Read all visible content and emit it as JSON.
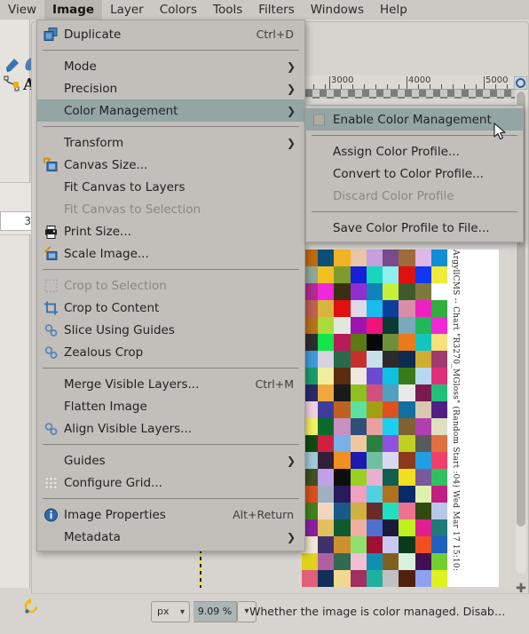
{
  "menubar": {
    "items": [
      {
        "label": "View",
        "active": false
      },
      {
        "label": "Image",
        "active": true
      },
      {
        "label": "Layer",
        "active": false
      },
      {
        "label": "Colors",
        "active": false
      },
      {
        "label": "Tools",
        "active": false
      },
      {
        "label": "Filters",
        "active": false
      },
      {
        "label": "Windows",
        "active": false
      },
      {
        "label": "Help",
        "active": false
      }
    ]
  },
  "image_menu": {
    "rows": [
      {
        "type": "item",
        "label": "Duplicate",
        "accel": "Ctrl+D",
        "icon": "duplicate-icon",
        "state": "normal"
      },
      {
        "type": "sep"
      },
      {
        "type": "item",
        "label": "Mode",
        "submenu": true,
        "state": "normal"
      },
      {
        "type": "item",
        "label": "Precision",
        "submenu": true,
        "state": "normal"
      },
      {
        "type": "item",
        "label": "Color Management",
        "submenu": true,
        "state": "highlighted"
      },
      {
        "type": "sep"
      },
      {
        "type": "item",
        "label": "Transform",
        "submenu": true,
        "state": "normal"
      },
      {
        "type": "item",
        "label": "Canvas Size...",
        "icon": "canvas-size-icon",
        "state": "normal"
      },
      {
        "type": "item",
        "label": "Fit Canvas to Layers",
        "state": "normal"
      },
      {
        "type": "item",
        "label": "Fit Canvas to Selection",
        "state": "disabled"
      },
      {
        "type": "item",
        "label": "Print Size...",
        "icon": "printer-icon",
        "state": "normal"
      },
      {
        "type": "item",
        "label": "Scale Image...",
        "icon": "scale-image-icon",
        "state": "normal"
      },
      {
        "type": "sep"
      },
      {
        "type": "item",
        "label": "Crop to Selection",
        "icon": "crop-selection-icon",
        "state": "disabled"
      },
      {
        "type": "item",
        "label": "Crop to Content",
        "icon": "crop-content-icon",
        "state": "normal"
      },
      {
        "type": "item",
        "label": "Slice Using Guides",
        "icon": "plugin-icon",
        "state": "normal"
      },
      {
        "type": "item",
        "label": "Zealous Crop",
        "icon": "plugin-icon",
        "state": "normal"
      },
      {
        "type": "sep"
      },
      {
        "type": "item",
        "label": "Merge Visible Layers...",
        "accel": "Ctrl+M",
        "state": "normal"
      },
      {
        "type": "item",
        "label": "Flatten Image",
        "state": "normal"
      },
      {
        "type": "item",
        "label": "Align Visible Layers...",
        "icon": "plugin-icon",
        "state": "normal"
      },
      {
        "type": "sep"
      },
      {
        "type": "item",
        "label": "Guides",
        "submenu": true,
        "state": "normal"
      },
      {
        "type": "item",
        "label": "Configure Grid...",
        "icon": "grid-icon",
        "state": "normal"
      },
      {
        "type": "sep"
      },
      {
        "type": "item",
        "label": "Image Properties",
        "accel": "Alt+Return",
        "icon": "info-icon",
        "state": "normal"
      },
      {
        "type": "item",
        "label": "Metadata",
        "submenu": true,
        "state": "normal"
      }
    ]
  },
  "color_management_submenu": {
    "rows": [
      {
        "type": "checkitem",
        "label": "Enable Color Management",
        "checked": false,
        "state": "highlighted"
      },
      {
        "type": "sep"
      },
      {
        "type": "item",
        "label": "Assign Color Profile...",
        "state": "normal"
      },
      {
        "type": "item",
        "label": "Convert to Color Profile...",
        "state": "normal"
      },
      {
        "type": "item",
        "label": "Discard Color Profile",
        "state": "disabled"
      },
      {
        "type": "sep"
      },
      {
        "type": "item",
        "label": "Save Color Profile to File...",
        "state": "normal"
      }
    ]
  },
  "canvas": {
    "vertical_caption": "ArgyllCMS -- Chart \"R3270_MGloss\" (Random Start :04) Wed Mar 17 15:10:",
    "ruler_labels": [
      "3000",
      "4000",
      "5000"
    ]
  },
  "statusbar": {
    "unit": "px",
    "zoom": "9.09 %",
    "message": "Whether the image is color managed. Disab…"
  },
  "left_panel": {
    "value": "3"
  },
  "colors": {
    "menu_bg": "#c2bfba",
    "menu_highlight": "#93a5a5",
    "menubar_bg": "#ccc8c3",
    "window_bg": "#d7d3ce",
    "zoom_field_bg": "#adb6b6",
    "layer_boundary_yellow": "#f7e400"
  },
  "chart_swatches": [
    "#c06a10",
    "#0b4f74",
    "#f0b323",
    "#e6c6a6",
    "#c79ee0",
    "#7a4b8a",
    "#a06a3c",
    "#dfb6e8",
    "#0e8fd8",
    "#8fa79a",
    "#f0c020",
    "#7f9b2e",
    "#1520d8",
    "#16d6c0",
    "#8df0ef",
    "#e01010",
    "#1038f0",
    "#f0ea3a",
    "#b32a94",
    "#f028d8",
    "#3a3010",
    "#8f2fd0",
    "#1084b8",
    "#c6f03a",
    "#3e5b2c",
    "#7f7a3c",
    "#ffffff",
    "#bf6050",
    "#d8b43e",
    "#e01010",
    "#e0d8e8",
    "#19baf0",
    "#0c3f9c",
    "#d88fa6",
    "#f01fc0",
    "#2fae3c",
    "#b87218",
    "#aada3c",
    "#dfe8da",
    "#9c14b0",
    "#f0147a",
    "#0b3a30",
    "#79aabc",
    "#21b85a",
    "#f028d8",
    "#2e2e2e",
    "#13e64a",
    "#b81a5a",
    "#5c7a12",
    "#080808",
    "#6f8f3c",
    "#eb7a1a",
    "#13c4c0",
    "#f7e17a",
    "#3c9cdb",
    "#d7d2e0",
    "#2a6a4a",
    "#c43030",
    "#c8e0ec",
    "#2b2b2b",
    "#0e2a50",
    "#d0ac30",
    "#a03a70",
    "#1b9c6a",
    "#eef0a0",
    "#5a2c10",
    "#f0e8e0",
    "#6c4ad0",
    "#10c0e0",
    "#3a7a1a",
    "#b8d8f0",
    "#e0307a",
    "#2a2a6a",
    "#f0a83c",
    "#1a1a1a",
    "#8fc020",
    "#d0507a",
    "#50a0c0",
    "#e8e8e8",
    "#7a1a50",
    "#20c07a",
    "#f0d0e0",
    "#3c3c9c",
    "#c06020",
    "#60e0a0",
    "#a0a010",
    "#e05020",
    "#1070a0",
    "#d8c8b0",
    "#502080",
    "#f0f060",
    "#0a6a2a",
    "#c890c0",
    "#30507a",
    "#e8a0a0",
    "#1ad0f0",
    "#806030",
    "#b040b0",
    "#e0e0c0",
    "#104a10",
    "#d02040",
    "#78b0e8",
    "#f0c8a0",
    "#2a8040",
    "#9050e0",
    "#c0d020",
    "#5a5a5a",
    "#e07040",
    "#a0c8d8",
    "#30203a",
    "#f09020",
    "#1b1bb0",
    "#70c0a0",
    "#d8d8f0",
    "#8a3a1a",
    "#20a0e0",
    "#f0406a",
    "#405020",
    "#c0a0e8",
    "#0e0e0e",
    "#9ad020",
    "#e8b0d0",
    "#106050",
    "#f0e020",
    "#7a5a9a",
    "#30c060",
    "#d85020",
    "#a0b0c0",
    "#2a1a5a",
    "#f0a0c0",
    "#50d0e0",
    "#b07020",
    "#0a2a6a",
    "#e0f0b0",
    "#c02080",
    "#408020",
    "#f0d8c0",
    "#1a5a8a",
    "#d0b040",
    "#6a2a2a",
    "#20e0c0",
    "#f07090",
    "#304a10",
    "#b8c8e8",
    "#8a20a0",
    "#e0c060",
    "#105a30",
    "#f0b0a0",
    "#5070d0",
    "#1a1a3a",
    "#c0f020",
    "#e02090",
    "#207a7a",
    "#f0e8d0",
    "#40306a",
    "#d09030",
    "#90e070",
    "#a01030",
    "#c8c8f0",
    "#0a3a1a",
    "#f05020",
    "#2060c0",
    "#e0d020",
    "#b060a0",
    "#306a50",
    "#f0c0d0",
    "#1090b0",
    "#806020",
    "#d8f0e0",
    "#401050",
    "#70d030",
    "#e0607a",
    "#10305a",
    "#f0d890",
    "#a03060",
    "#20b0a0",
    "#c0c0c0",
    "#502010",
    "#90a0f0",
    "#e0f020",
    "#b82010",
    "#30a070",
    "#f0a8e0",
    "#2a3a20",
    "#d0d0a0",
    "#6020b0",
    "#10c080",
    "#e88040",
    "#a8b8d0",
    "#1a0a2a",
    "#f0e0a0",
    "#2080a0",
    "#c04060",
    "#70a020",
    "#e0a0f0",
    "#30503a",
    "#f06030",
    "#a0d0e0",
    "#503090",
    "#0e2a2a"
  ]
}
